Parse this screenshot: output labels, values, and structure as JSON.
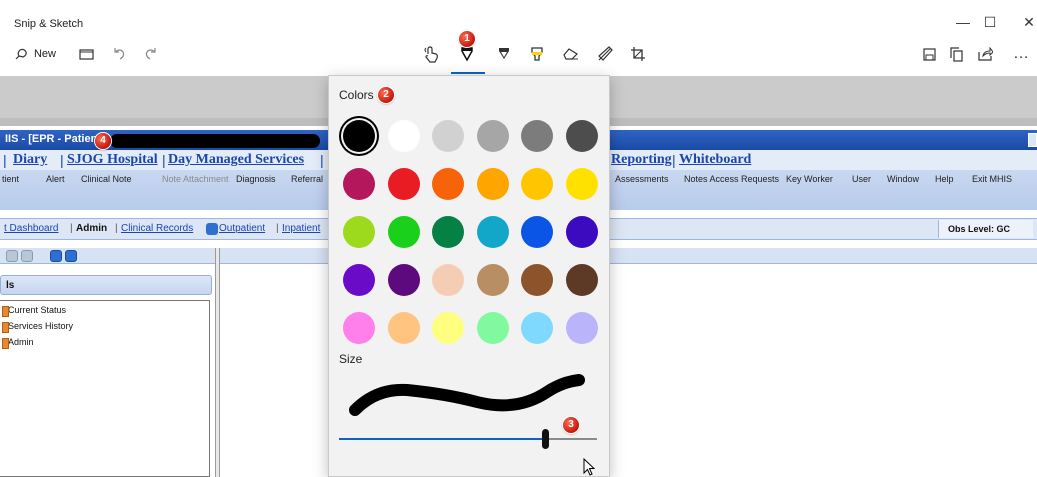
{
  "window": {
    "title": "Snip & Sketch",
    "minimize": "—",
    "maximize": "☐",
    "close": "✕"
  },
  "toolbar": {
    "new_label": "New",
    "icons": [
      "new-snip-icon",
      "open-folder-icon",
      "undo-icon",
      "redo-icon",
      "touch-writing-icon",
      "ballpoint-pen-icon",
      "pencil-icon",
      "highlighter-icon",
      "eraser-icon",
      "ruler-icon",
      "crop-icon",
      "save-icon",
      "copy-icon",
      "share-icon",
      "more-icon"
    ],
    "more_label": "…",
    "active_tool": "ballpoint-pen"
  },
  "annotations": [
    "1",
    "2",
    "3",
    "4"
  ],
  "background_app": {
    "title_text": "IIS - [EPR - Patient",
    "nav_links": [
      "Diary",
      "SJOG Hospital",
      "Day Managed Services",
      "Reporting",
      "Whiteboard"
    ],
    "nav_sep": "|",
    "menu_items_left": [
      "tient",
      "Alert",
      "Clinical Note",
      "Note Attachment",
      "Diagnosis",
      "Referral"
    ],
    "menu_items_right": [
      "Assessments",
      "Notes Access Requests",
      "Key Worker",
      "User",
      "Window",
      "Help",
      "Exit MHIS"
    ],
    "breadcrumbs": [
      "t Dashboard",
      "Admin",
      "Clinical Records",
      "Outpatient",
      "Inpatient"
    ],
    "obs_level": "Obs Level: GC",
    "tree_header": "ls",
    "tree_items": [
      "Current Status",
      "Services History",
      "Admin"
    ]
  },
  "flyout": {
    "colors_label": "Colors",
    "size_label": "Size",
    "selected_color": "#000000",
    "pen_size_fraction": 0.8,
    "colors": [
      [
        "#000000",
        "#ffffff",
        "#d1d1d1",
        "#a6a6a6",
        "#7c7c7c",
        "#4d4d4d"
      ],
      [
        "#b5175d",
        "#e91c24",
        "#f76308",
        "#ffa500",
        "#ffc600",
        "#ffe100"
      ],
      [
        "#9dd91c",
        "#1ad01a",
        "#058145",
        "#12a7c9",
        "#0a55e6",
        "#3d0bbf"
      ],
      [
        "#6a0bc8",
        "#5e0a7f",
        "#f5cdb4",
        "#b88e64",
        "#8b542b",
        "#5c3a25"
      ],
      [
        "#ff80ea",
        "#ffc47f",
        "#ffff7f",
        "#80f99f",
        "#7fd9fe",
        "#bab4fa"
      ]
    ]
  }
}
